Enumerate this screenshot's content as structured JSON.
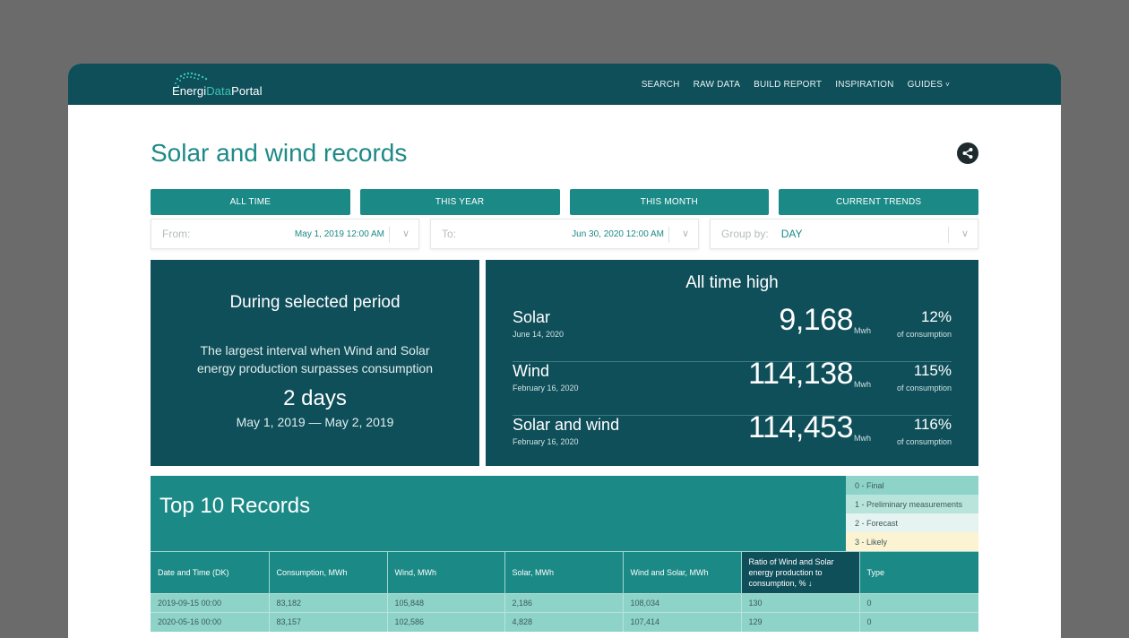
{
  "nav": {
    "logo_part1": "Energi",
    "logo_part2": "Data",
    "logo_part3": "Portal",
    "links": [
      "SEARCH",
      "RAW DATA",
      "BUILD REPORT",
      "INSPIRATION",
      "GUIDES"
    ]
  },
  "page": {
    "title": "Solar and wind records"
  },
  "periods": [
    "ALL TIME",
    "THIS YEAR",
    "THIS MONTH",
    "CURRENT TRENDS"
  ],
  "filters": {
    "from_label": "From:",
    "from_value": "May 1, 2019 12:00 AM",
    "to_label": "To:",
    "to_value": "Jun 30, 2020 12:00 AM",
    "group_label": "Group by:",
    "group_value": "DAY"
  },
  "period_panel": {
    "title": "During selected period",
    "description": "The largest interval when Wind and Solar energy production surpasses consumption",
    "value": "2 days",
    "range": "May 1, 2019 — May 2, 2019"
  },
  "all_time_high": {
    "title": "All time high",
    "records": [
      {
        "name": "Solar",
        "date": "June 14, 2020",
        "value": "9,168",
        "unit": "Mwh",
        "pct": "12%",
        "pct_label": "of consumption"
      },
      {
        "name": "Wind",
        "date": "February 16, 2020",
        "value": "114,138",
        "unit": "Mwh",
        "pct": "115%",
        "pct_label": "of consumption"
      },
      {
        "name": "Solar and wind",
        "date": "February 16, 2020",
        "value": "114,453",
        "unit": "Mwh",
        "pct": "116%",
        "pct_label": "of consumption"
      }
    ]
  },
  "top10": {
    "title": "Top 10 Records",
    "legend": [
      "0 - Final",
      "1 - Preliminary measurements",
      "2 - Forecast",
      "3 - Likely"
    ],
    "legend_colors": [
      "#8ed3c8",
      "#b9e4dc",
      "#e6f4f1",
      "#fbf3d2"
    ],
    "columns": [
      "Date and Time (DK)",
      "Consumption, MWh",
      "Wind, MWh",
      "Solar, MWh",
      "Wind and Solar, MWh",
      "Ratio of Wind and Solar energy production to consumption, % ↓",
      "Type"
    ],
    "rows": [
      [
        "2019-09-15 00:00",
        "83,182",
        "105,848",
        "2,186",
        "108,034",
        "130",
        "0"
      ],
      [
        "2020-05-16 00:00",
        "83,157",
        "102,586",
        "4,828",
        "107,414",
        "129",
        "0"
      ]
    ]
  },
  "colors": {
    "brand_dark": "#0f4f5a",
    "brand_teal": "#1b8a86",
    "title_teal": "#1e8a86"
  }
}
